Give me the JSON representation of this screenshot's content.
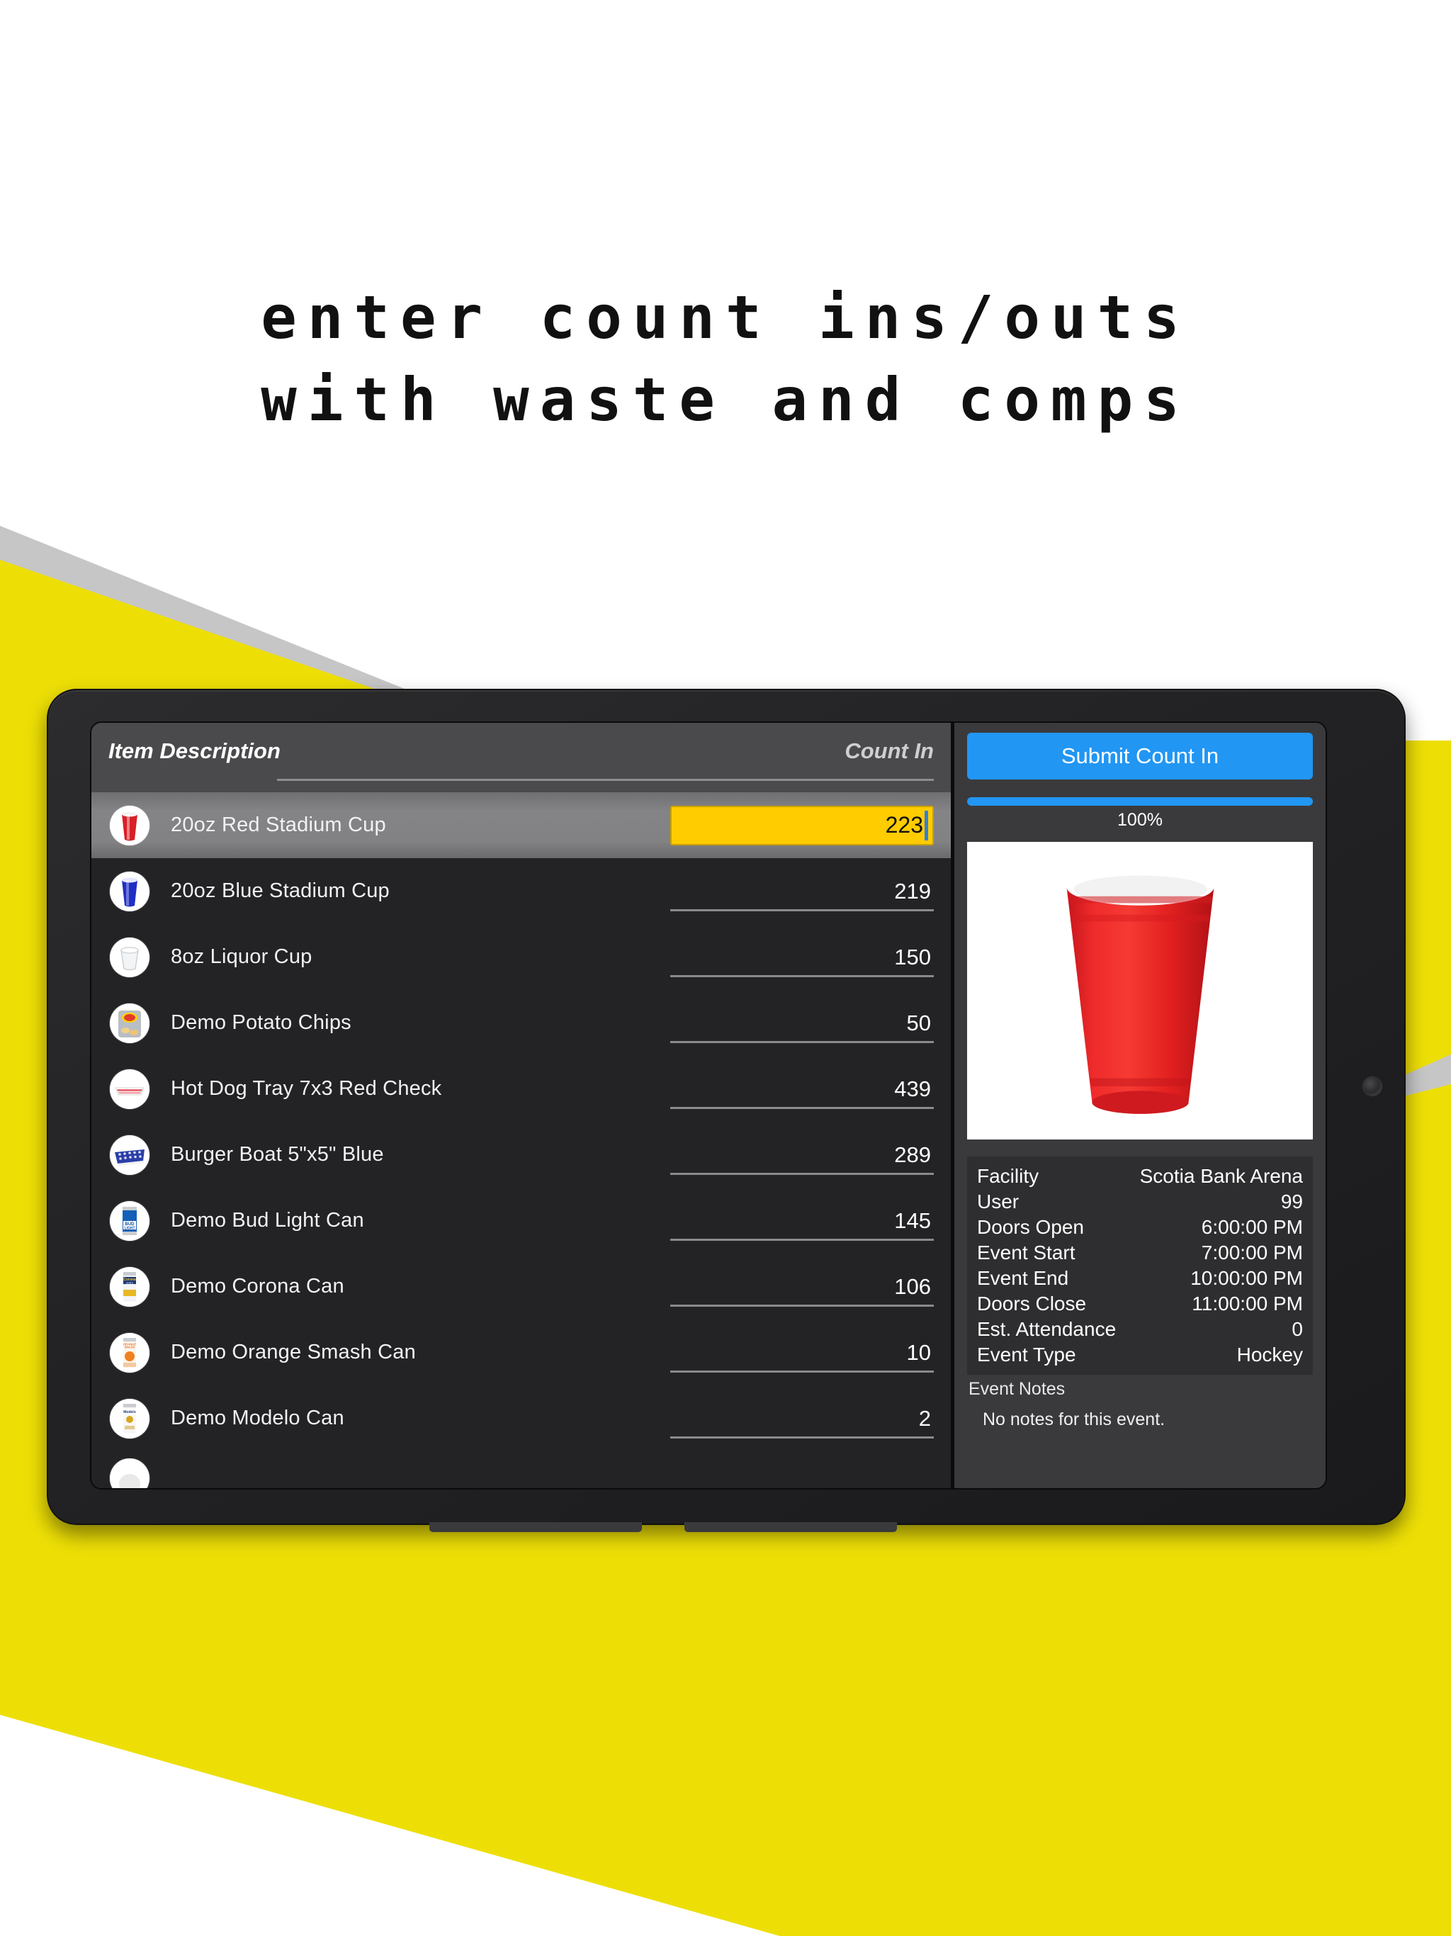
{
  "headline": {
    "line1": "enter count ins/outs",
    "line2": "with waste and comps"
  },
  "colors": {
    "brand_yellow": "#EDDF06",
    "accent_blue": "#2196F3",
    "input_highlight": "#FFCC00",
    "panel_dark": "#232325",
    "panel_mid": "#3A3A3C",
    "header_gray": "#4A4A4C",
    "gray_stripe": "#C6C6C6"
  },
  "list": {
    "header": {
      "item_column": "Item Description",
      "count_column": "Count In"
    },
    "rows": [
      {
        "icon": "red-stadium-cup-icon",
        "label": "20oz Red Stadium Cup",
        "value": "223",
        "selected": true
      },
      {
        "icon": "blue-stadium-cup-icon",
        "label": "20oz Blue Stadium Cup",
        "value": "219",
        "selected": false
      },
      {
        "icon": "liquor-cup-icon",
        "label": "8oz Liquor Cup",
        "value": "150",
        "selected": false
      },
      {
        "icon": "potato-chips-icon",
        "label": "Demo Potato Chips",
        "value": "50",
        "selected": false
      },
      {
        "icon": "hot-dog-tray-icon",
        "label": "Hot Dog Tray 7x3 Red Check",
        "value": "439",
        "selected": false
      },
      {
        "icon": "burger-boat-icon",
        "label": "Burger Boat 5\"x5\" Blue",
        "value": "289",
        "selected": false
      },
      {
        "icon": "bud-light-can-icon",
        "label": "Demo Bud Light Can",
        "value": "145",
        "selected": false
      },
      {
        "icon": "corona-can-icon",
        "label": "Demo Corona Can",
        "value": "106",
        "selected": false
      },
      {
        "icon": "orange-smash-can-icon",
        "label": "Demo Orange Smash Can",
        "value": "10",
        "selected": false
      },
      {
        "icon": "modelo-can-icon",
        "label": "Demo Modelo Can",
        "value": "2",
        "selected": false
      }
    ]
  },
  "detail": {
    "submit_label": "Submit Count In",
    "progress_percent": "100%",
    "progress_value": 100,
    "product_image_alt": "red-stadium-cup-photo",
    "event": [
      {
        "key": "Facility",
        "value": "Scotia Bank Arena"
      },
      {
        "key": "User",
        "value": "99"
      },
      {
        "key": "Doors Open",
        "value": "6:00:00 PM"
      },
      {
        "key": "Event Start",
        "value": "7:00:00 PM"
      },
      {
        "key": "Event End",
        "value": "10:00:00 PM"
      },
      {
        "key": "Doors Close",
        "value": "11:00:00 PM"
      },
      {
        "key": "Est. Attendance",
        "value": "0"
      },
      {
        "key": "Event Type",
        "value": "Hockey"
      }
    ],
    "notes_title": "Event Notes",
    "notes_body": "No notes for this event."
  }
}
